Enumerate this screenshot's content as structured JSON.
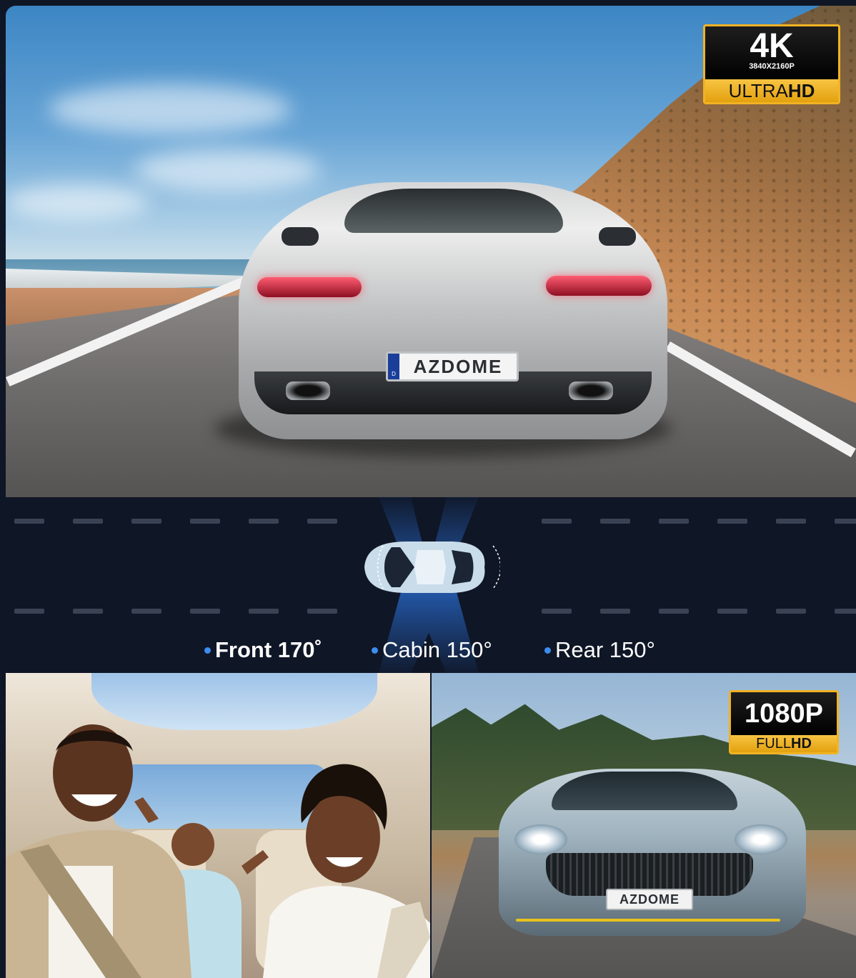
{
  "top_image": {
    "plate_text": "AZDOME",
    "plate_country": "D",
    "badge": {
      "main": "4K",
      "resolution": "3840X2160P",
      "label_light": "ULTRA",
      "label_bold": "HD"
    }
  },
  "diagram": {
    "angles": [
      {
        "label": "Front 170˚"
      },
      {
        "label": "Cabin 150°"
      },
      {
        "label": "Rear 150°"
      }
    ],
    "colors": {
      "background": "#0f1626",
      "beam": "#2f7df2",
      "dot": "#3c8df0"
    }
  },
  "front_image": {
    "plate_text": "AZDOME",
    "badge": {
      "main": "1080P",
      "label_light": "FULL",
      "label_bold": "HD"
    }
  },
  "colors": {
    "badge_gold": "#f0b323"
  }
}
